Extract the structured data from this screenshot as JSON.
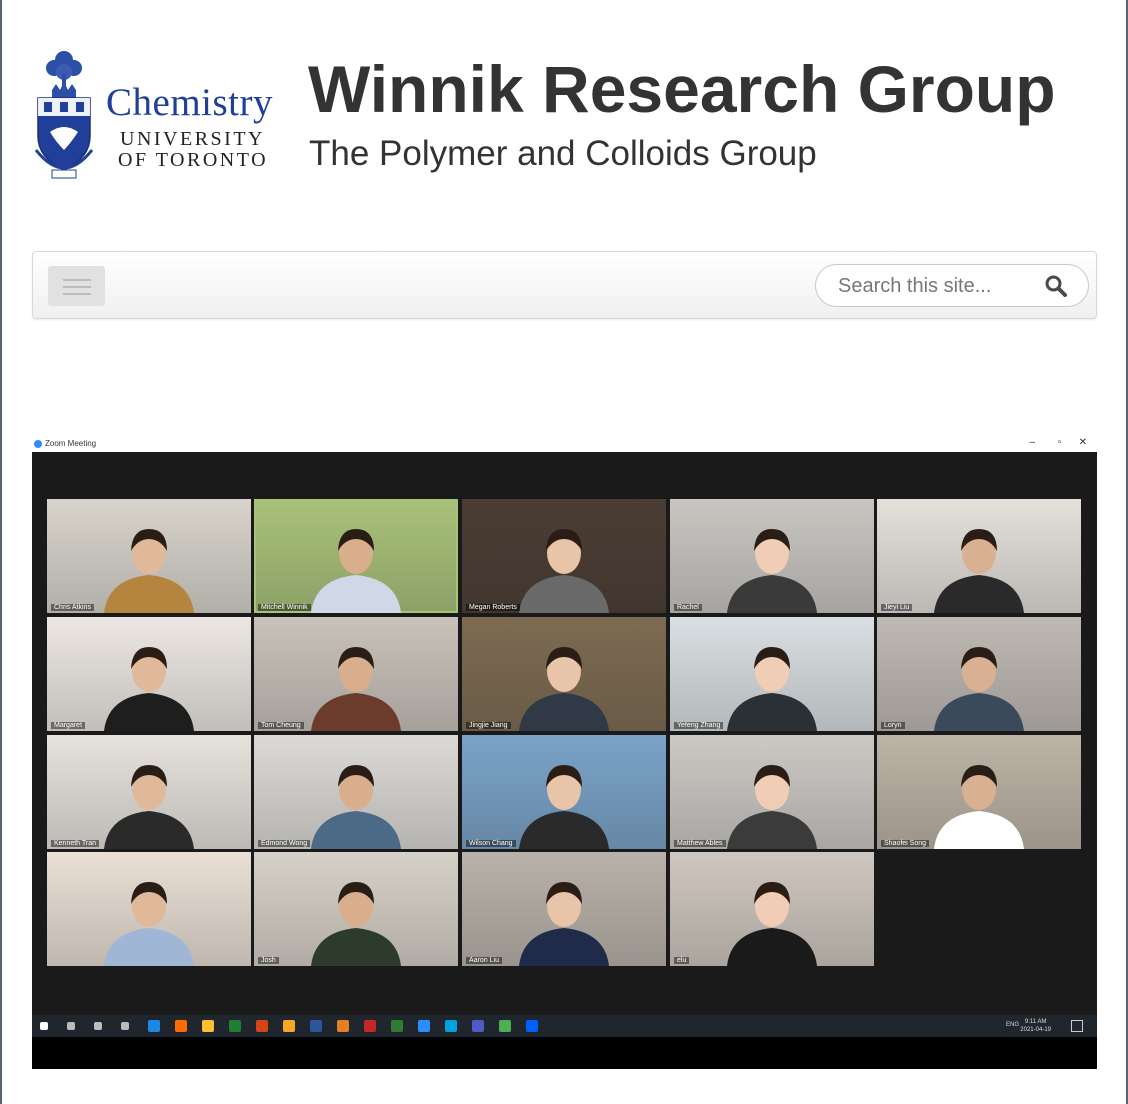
{
  "header": {
    "logo": {
      "chemistry": "Chemistry",
      "university": "UNIVERSITY",
      "of_toronto": "OF TORONTO"
    },
    "title": "Winnik Research Group",
    "subtitle": "The Polymer and Colloids Group"
  },
  "navbar": {
    "search_placeholder": "Search this site..."
  },
  "zoom": {
    "window_title": "Zoom Meeting",
    "participants": [
      "Chris Atkins",
      "Mitchell Winnik",
      "Megan Roberts",
      "Rachel",
      "Jieyi Liu",
      "Margaret",
      "Tom Cheung",
      "Jingjie Jiang",
      "Yefeng Zhang",
      "Loryn",
      "Kenneth Tran",
      "Edmond Wong",
      "Wilson Chang",
      "Matthew Ables",
      "Shaofei Song",
      "",
      "Josh",
      "Aaron Liu",
      "elu"
    ]
  },
  "taskbar": {
    "language": "ENG",
    "time": "9:11 AM",
    "date": "2021-04-19"
  },
  "colors": {
    "accent": "#1f3f99",
    "zoom_bg": "#1a1a1a",
    "active_speaker": "#9bd64c"
  }
}
